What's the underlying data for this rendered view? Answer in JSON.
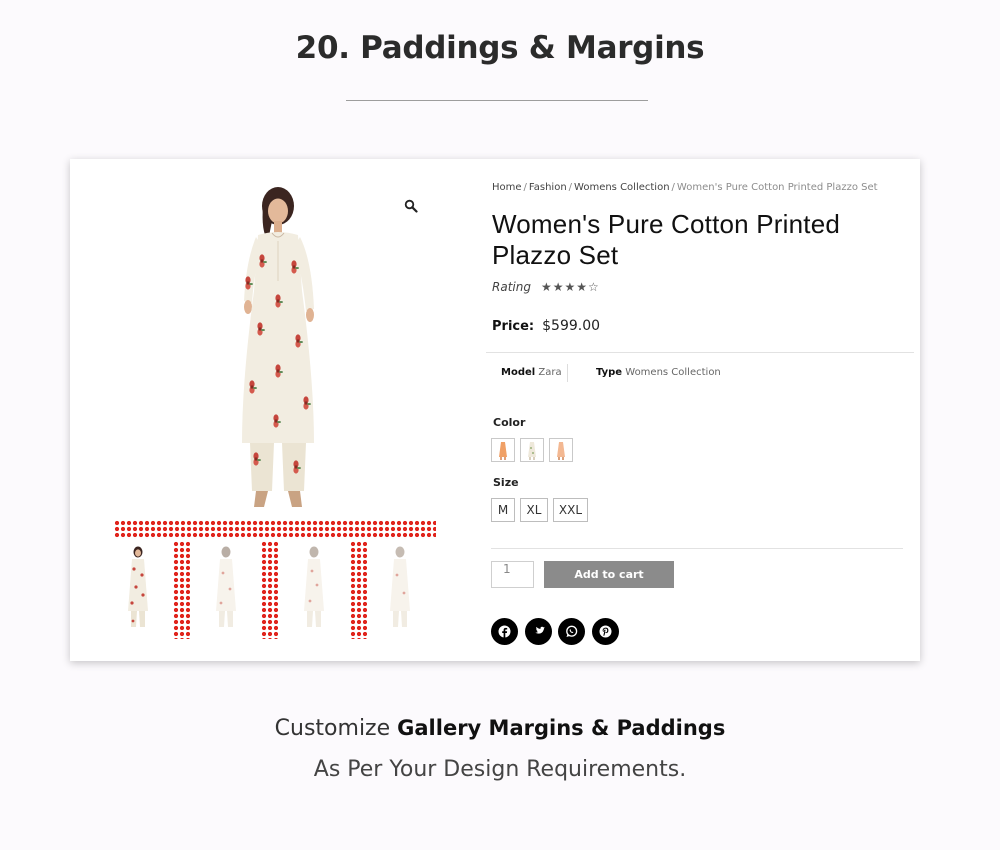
{
  "header": {
    "title": "20. Paddings & Margins"
  },
  "product": {
    "breadcrumb": {
      "items": [
        "Home",
        "Fashion",
        "Womens Collection"
      ],
      "current": "Women's Pure Cotton Printed Plazzo Set",
      "separator": "/"
    },
    "title": "Women's Pure Cotton Printed Plazzo Set",
    "rating_label": "Rating",
    "rating_value": 4,
    "rating_max": 5,
    "rating_stars": "★★★★☆",
    "price_label": "Price:",
    "price": "$599.00",
    "meta": {
      "model_label": "Model",
      "model_value": "Zara",
      "type_label": "Type",
      "type_value": "Womens Collection"
    },
    "color_label": "Color",
    "color_swatches": [
      "orange-swatch",
      "white-swatch",
      "peach-swatch"
    ],
    "size_label": "Size",
    "sizes": [
      "M",
      "XL",
      "XXL"
    ],
    "quantity": "1",
    "add_to_cart_label": "Add to cart",
    "social": [
      "facebook-icon",
      "twitter-icon",
      "whatsapp-icon",
      "pinterest-icon"
    ]
  },
  "colors": {
    "accent_red": "#e0241c",
    "button_gray": "#8b8b8b",
    "kurta": "#f2ede1",
    "print": "#c6463d"
  },
  "caption": {
    "prefix": "Customize",
    "highlight": "Gallery Margins & Paddings",
    "line2": "As Per Your Design Requirements."
  }
}
